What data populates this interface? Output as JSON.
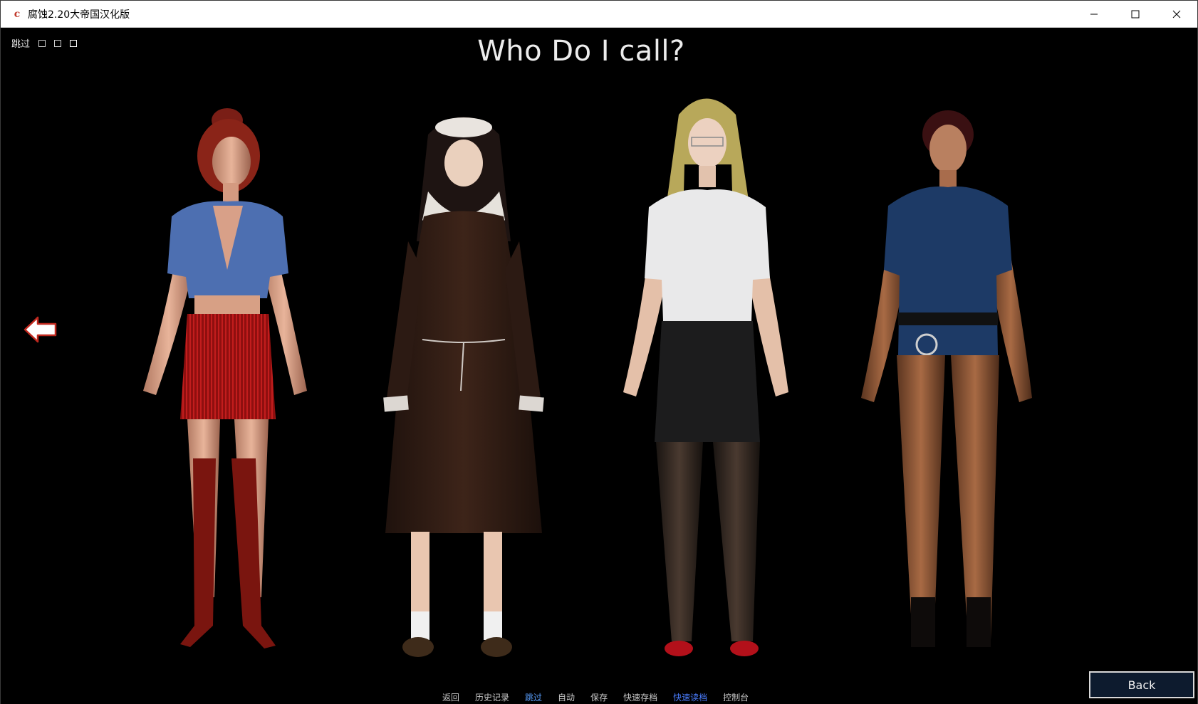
{
  "window": {
    "title": "腐蚀2.20大帝国汉化版",
    "icon_glyph": "c",
    "controls": [
      "minimize-icon",
      "maximize-icon",
      "close-icon"
    ]
  },
  "game": {
    "skip_label": "跳过",
    "title": "Who Do I call?",
    "nav_arrow_icon": "arrow-left-icon",
    "characters": [
      {
        "id": "redhead-casual",
        "outfit": "blue shirt, red skirt"
      },
      {
        "id": "nun",
        "outfit": "nun habit"
      },
      {
        "id": "office-glasses",
        "outfit": "white blouse, black skirt"
      },
      {
        "id": "police",
        "outfit": "blue police uniform"
      }
    ],
    "quick_menu": {
      "items": [
        "返回",
        "历史记录",
        "跳过",
        "自动",
        "保存",
        "快速存档",
        "快速读档",
        "控制台"
      ]
    },
    "back_label": "Back"
  },
  "colors": {
    "background": "#000000",
    "title_text": "#ececec",
    "quick_menu_text": "#c9c9c9",
    "quick_menu_active": "#5aa0ff",
    "back_button_bg": "#0d1b2e"
  }
}
